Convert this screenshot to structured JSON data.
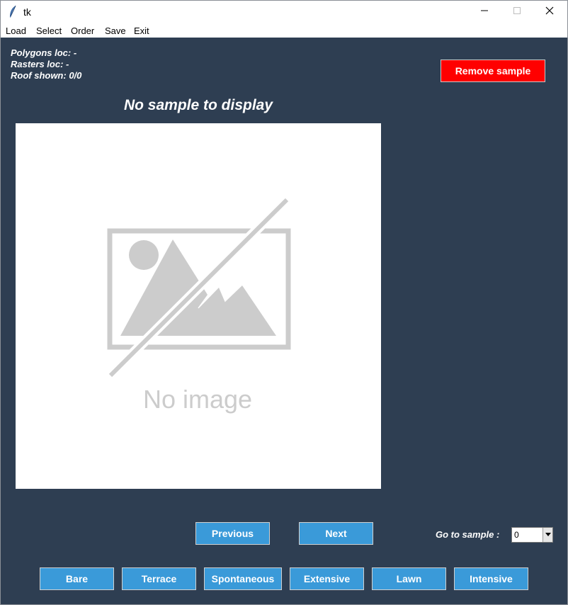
{
  "window": {
    "title": "tk"
  },
  "menu": {
    "items": [
      "Load",
      "Select",
      "Order",
      "Save",
      "Exit"
    ]
  },
  "info": {
    "polygons": "Polygons loc: -",
    "rasters": "Rasters loc: -",
    "roof": "Roof shown: 0/0"
  },
  "actions": {
    "remove_label": "Remove sample",
    "remove_color": "#ff0000"
  },
  "sample": {
    "title": "No sample to display",
    "placeholder_text": "No image"
  },
  "navigation": {
    "previous_label": "Previous",
    "next_label": "Next",
    "goto_label": "Go to sample :",
    "goto_value": "0"
  },
  "categories": [
    "Bare",
    "Terrace",
    "Spontaneous",
    "Extensive",
    "Lawn",
    "Intensive"
  ],
  "colors": {
    "background": "#2e3e52",
    "button": "#3a9ad9",
    "placeholder_gray": "#cccccc"
  },
  "icons": {
    "app": "feather-icon",
    "minimize": "minimize-icon",
    "maximize": "maximize-icon",
    "close": "close-icon",
    "dropdown": "chevron-down-icon",
    "placeholder": "no-image-icon"
  }
}
